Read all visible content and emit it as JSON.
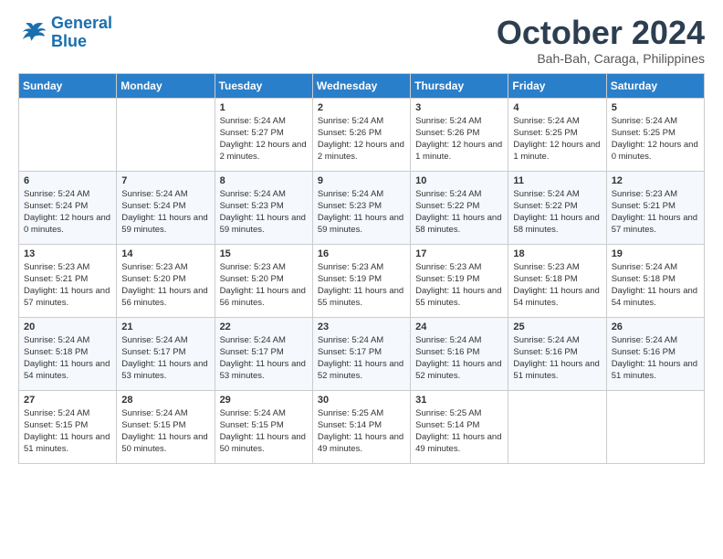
{
  "header": {
    "logo_line1": "General",
    "logo_line2": "Blue",
    "month": "October 2024",
    "location": "Bah-Bah, Caraga, Philippines"
  },
  "days_of_week": [
    "Sunday",
    "Monday",
    "Tuesday",
    "Wednesday",
    "Thursday",
    "Friday",
    "Saturday"
  ],
  "weeks": [
    [
      {
        "day": "",
        "info": ""
      },
      {
        "day": "",
        "info": ""
      },
      {
        "day": "1",
        "info": "Sunrise: 5:24 AM\nSunset: 5:27 PM\nDaylight: 12 hours and 2 minutes."
      },
      {
        "day": "2",
        "info": "Sunrise: 5:24 AM\nSunset: 5:26 PM\nDaylight: 12 hours and 2 minutes."
      },
      {
        "day": "3",
        "info": "Sunrise: 5:24 AM\nSunset: 5:26 PM\nDaylight: 12 hours and 1 minute."
      },
      {
        "day": "4",
        "info": "Sunrise: 5:24 AM\nSunset: 5:25 PM\nDaylight: 12 hours and 1 minute."
      },
      {
        "day": "5",
        "info": "Sunrise: 5:24 AM\nSunset: 5:25 PM\nDaylight: 12 hours and 0 minutes."
      }
    ],
    [
      {
        "day": "6",
        "info": "Sunrise: 5:24 AM\nSunset: 5:24 PM\nDaylight: 12 hours and 0 minutes."
      },
      {
        "day": "7",
        "info": "Sunrise: 5:24 AM\nSunset: 5:24 PM\nDaylight: 11 hours and 59 minutes."
      },
      {
        "day": "8",
        "info": "Sunrise: 5:24 AM\nSunset: 5:23 PM\nDaylight: 11 hours and 59 minutes."
      },
      {
        "day": "9",
        "info": "Sunrise: 5:24 AM\nSunset: 5:23 PM\nDaylight: 11 hours and 59 minutes."
      },
      {
        "day": "10",
        "info": "Sunrise: 5:24 AM\nSunset: 5:22 PM\nDaylight: 11 hours and 58 minutes."
      },
      {
        "day": "11",
        "info": "Sunrise: 5:24 AM\nSunset: 5:22 PM\nDaylight: 11 hours and 58 minutes."
      },
      {
        "day": "12",
        "info": "Sunrise: 5:23 AM\nSunset: 5:21 PM\nDaylight: 11 hours and 57 minutes."
      }
    ],
    [
      {
        "day": "13",
        "info": "Sunrise: 5:23 AM\nSunset: 5:21 PM\nDaylight: 11 hours and 57 minutes."
      },
      {
        "day": "14",
        "info": "Sunrise: 5:23 AM\nSunset: 5:20 PM\nDaylight: 11 hours and 56 minutes."
      },
      {
        "day": "15",
        "info": "Sunrise: 5:23 AM\nSunset: 5:20 PM\nDaylight: 11 hours and 56 minutes."
      },
      {
        "day": "16",
        "info": "Sunrise: 5:23 AM\nSunset: 5:19 PM\nDaylight: 11 hours and 55 minutes."
      },
      {
        "day": "17",
        "info": "Sunrise: 5:23 AM\nSunset: 5:19 PM\nDaylight: 11 hours and 55 minutes."
      },
      {
        "day": "18",
        "info": "Sunrise: 5:23 AM\nSunset: 5:18 PM\nDaylight: 11 hours and 54 minutes."
      },
      {
        "day": "19",
        "info": "Sunrise: 5:24 AM\nSunset: 5:18 PM\nDaylight: 11 hours and 54 minutes."
      }
    ],
    [
      {
        "day": "20",
        "info": "Sunrise: 5:24 AM\nSunset: 5:18 PM\nDaylight: 11 hours and 54 minutes."
      },
      {
        "day": "21",
        "info": "Sunrise: 5:24 AM\nSunset: 5:17 PM\nDaylight: 11 hours and 53 minutes."
      },
      {
        "day": "22",
        "info": "Sunrise: 5:24 AM\nSunset: 5:17 PM\nDaylight: 11 hours and 53 minutes."
      },
      {
        "day": "23",
        "info": "Sunrise: 5:24 AM\nSunset: 5:17 PM\nDaylight: 11 hours and 52 minutes."
      },
      {
        "day": "24",
        "info": "Sunrise: 5:24 AM\nSunset: 5:16 PM\nDaylight: 11 hours and 52 minutes."
      },
      {
        "day": "25",
        "info": "Sunrise: 5:24 AM\nSunset: 5:16 PM\nDaylight: 11 hours and 51 minutes."
      },
      {
        "day": "26",
        "info": "Sunrise: 5:24 AM\nSunset: 5:16 PM\nDaylight: 11 hours and 51 minutes."
      }
    ],
    [
      {
        "day": "27",
        "info": "Sunrise: 5:24 AM\nSunset: 5:15 PM\nDaylight: 11 hours and 51 minutes."
      },
      {
        "day": "28",
        "info": "Sunrise: 5:24 AM\nSunset: 5:15 PM\nDaylight: 11 hours and 50 minutes."
      },
      {
        "day": "29",
        "info": "Sunrise: 5:24 AM\nSunset: 5:15 PM\nDaylight: 11 hours and 50 minutes."
      },
      {
        "day": "30",
        "info": "Sunrise: 5:25 AM\nSunset: 5:14 PM\nDaylight: 11 hours and 49 minutes."
      },
      {
        "day": "31",
        "info": "Sunrise: 5:25 AM\nSunset: 5:14 PM\nDaylight: 11 hours and 49 minutes."
      },
      {
        "day": "",
        "info": ""
      },
      {
        "day": "",
        "info": ""
      }
    ]
  ]
}
